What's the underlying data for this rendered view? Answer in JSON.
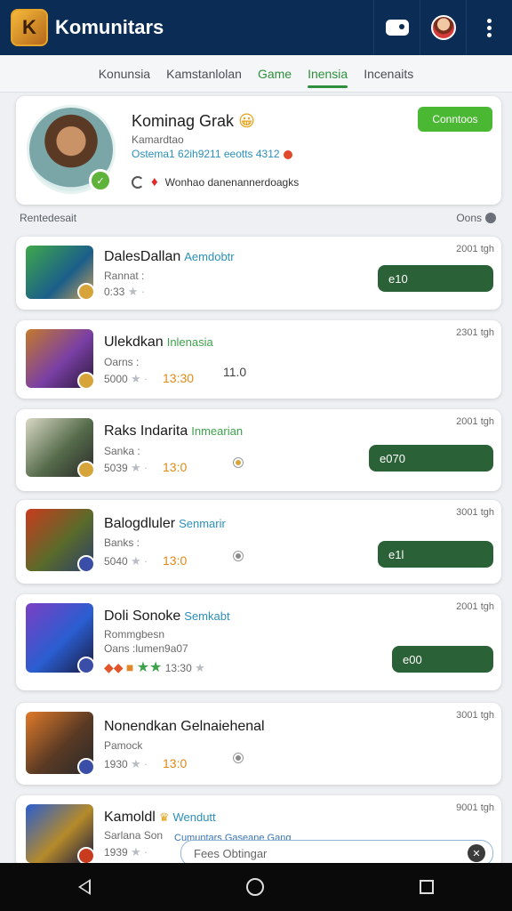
{
  "app": {
    "title": "Komunitars",
    "logo_letters": "K"
  },
  "tabs": [
    {
      "label": "Konunsia"
    },
    {
      "label": "Kamstanlolan"
    },
    {
      "label": "Game"
    },
    {
      "label": "Inensia",
      "active": true
    },
    {
      "label": "Incenaits"
    }
  ],
  "profile": {
    "name": "Kominag Grak",
    "emoji": "😀",
    "sub": "Kamardtao",
    "stat": "Ostema1 62ih9211 eeotts 4312",
    "activity": "Wonhao danenannerdoagks",
    "level": "✓",
    "follow_label": "Conntoos"
  },
  "section": {
    "title": "Rentedesait",
    "right_label": "Oons"
  },
  "games": [
    {
      "title": "DalesDallan",
      "tag": "Aemdobtr",
      "tag_color": "#2b8fb8",
      "sub": "Rannat :",
      "rating": "0:33",
      "count": "",
      "time": "2001 tgh",
      "button": "e10"
    },
    {
      "title": "Ulekdkan",
      "tag": "Inlenasia",
      "tag_color": "#3ca24a",
      "sub": "Oarns :",
      "rating": "5000",
      "count": "13:30",
      "extra": "11.0",
      "time": "2301 tgh",
      "button": ""
    },
    {
      "title": "Raks Indarita",
      "tag": "Inmearian",
      "tag_color": "#3ca24a",
      "sub": "Sanka :",
      "rating": "5039",
      "count": "13:0",
      "time": "2001 tgh",
      "button": "e070"
    },
    {
      "title": "Balogdluler",
      "tag": "Senmarir",
      "tag_color": "#2b8fb8",
      "sub": "Banks :",
      "rating": "5040",
      "count": "13:0",
      "time": "3001 tgh",
      "button": "e1l"
    },
    {
      "title": "Doli Sonoke",
      "tag": "Semkabt",
      "tag_color": "#2b8fb8",
      "sub": "Rommgbesn",
      "sub2": "Oans :lumen9a07",
      "rating": "13:30",
      "count": "",
      "time": "2001 tgh",
      "button": "e00"
    },
    {
      "title": "Nonendkan Gelnaiehenal",
      "tag": "",
      "tag_color": "#2b8fb8",
      "sub": "Pamock",
      "rating": "1930",
      "count": "13:0",
      "time": "3001 tgh",
      "button": ""
    },
    {
      "title": "Kamoldl",
      "tag": "Wendutt",
      "tag_color": "#e0a21a",
      "sub": "Sarlana Son",
      "rating": "1939",
      "count": "",
      "time": "9001 tgh",
      "button": ""
    }
  ],
  "search": {
    "label": "Cumuntars Gaseane Gang",
    "placeholder": "Fees Obtingar"
  }
}
